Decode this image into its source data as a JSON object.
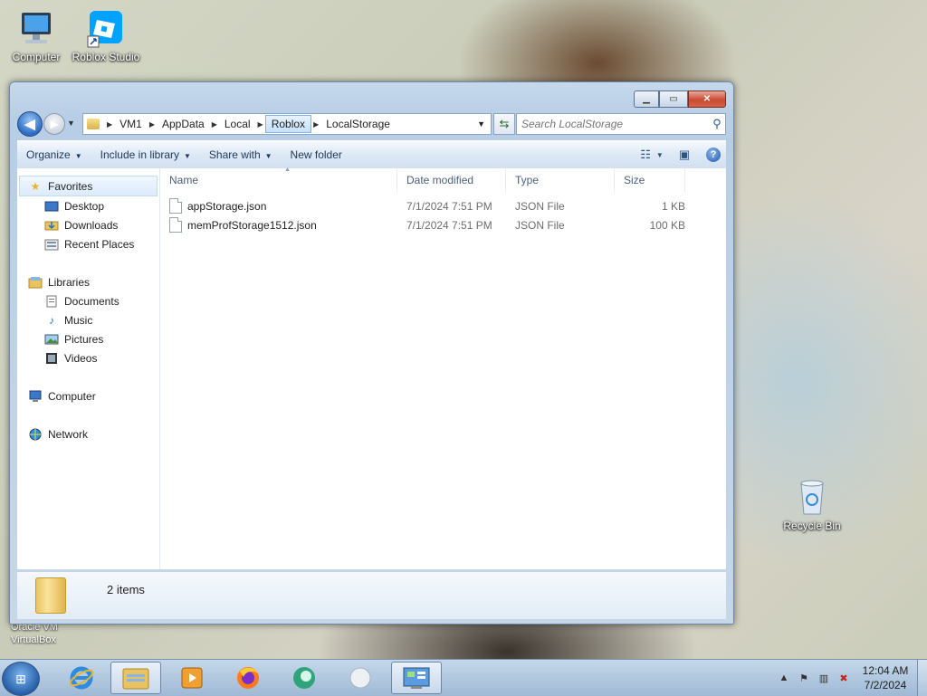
{
  "desktop": {
    "icons": [
      {
        "label": "Computer"
      },
      {
        "label": "Roblox Studio"
      },
      {
        "label": "Recycle Bin"
      }
    ],
    "vbox_text_1": "Oracle VM",
    "vbox_text_2": "VirtualBox"
  },
  "window": {
    "address": {
      "crumbs": [
        "VM1",
        "AppData",
        "Local",
        "Roblox",
        "LocalStorage"
      ]
    },
    "search": {
      "placeholder": "Search LocalStorage"
    },
    "toolbar": {
      "organize": "Organize",
      "include": "Include in library",
      "share": "Share with",
      "new_folder": "New folder"
    },
    "nav": {
      "favorites": "Favorites",
      "desktop": "Desktop",
      "downloads": "Downloads",
      "recent": "Recent Places",
      "libraries": "Libraries",
      "documents": "Documents",
      "music": "Music",
      "pictures": "Pictures",
      "videos": "Videos",
      "computer": "Computer",
      "network": "Network"
    },
    "columns": {
      "name": "Name",
      "date": "Date modified",
      "type": "Type",
      "size": "Size"
    },
    "files": [
      {
        "name": "appStorage.json",
        "date": "7/1/2024 7:51 PM",
        "type": "JSON File",
        "size": "1 KB"
      },
      {
        "name": "memProfStorage1512.json",
        "date": "7/1/2024 7:51 PM",
        "type": "JSON File",
        "size": "100 KB"
      }
    ],
    "details": {
      "count": "2 items"
    }
  },
  "taskbar": {
    "clock": {
      "time": "12:04 AM",
      "date": "7/2/2024"
    },
    "colors": {
      "accent": "#245ea6"
    }
  }
}
